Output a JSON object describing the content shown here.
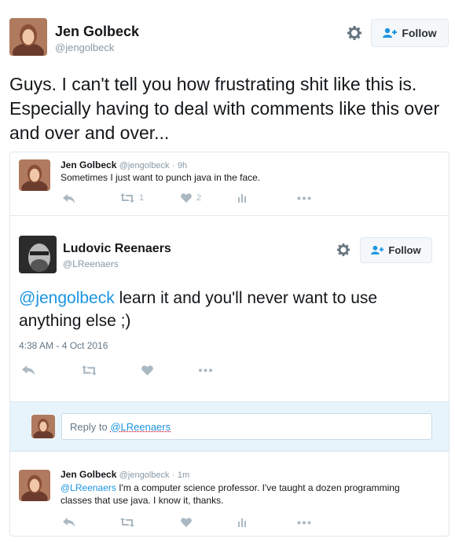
{
  "main_tweet": {
    "name": "Jen Golbeck",
    "handle": "@jengolbeck",
    "follow_label": "Follow",
    "text": "Guys. I can't tell you how frustrating shit like this is. Especially having to deal with comments like this over and over and over..."
  },
  "quoted_tweet_1": {
    "name": "Jen Golbeck",
    "handle": "@jengolbeck",
    "separator": "·",
    "time": "9h",
    "text": "Sometimes I just want to punch java in the face.",
    "retweets": "1",
    "likes": "2"
  },
  "expanded_tweet": {
    "name": "Ludovic Reenaers",
    "handle": "@LReenaers",
    "follow_label": "Follow",
    "mention": "@jengolbeck",
    "text": " learn it and you'll never want to use anything else ;)",
    "timestamp": "4:38 AM - 4 Oct 2016"
  },
  "reply_box": {
    "prefix": "Reply to ",
    "mention": "@LReenaers"
  },
  "reply_tweet": {
    "name": "Jen Golbeck",
    "handle": "@jengolbeck",
    "separator": "·",
    "time": "1m",
    "mention": "@LReenaers",
    "text": " I'm a computer science professor. I've taught a dozen programming classes that use java. I know it, thanks."
  },
  "colors": {
    "link": "#1b95e0",
    "icon_gray": "#aab8c2",
    "handle_gray": "#8899a6",
    "reply_bg": "#e8f4fb"
  }
}
